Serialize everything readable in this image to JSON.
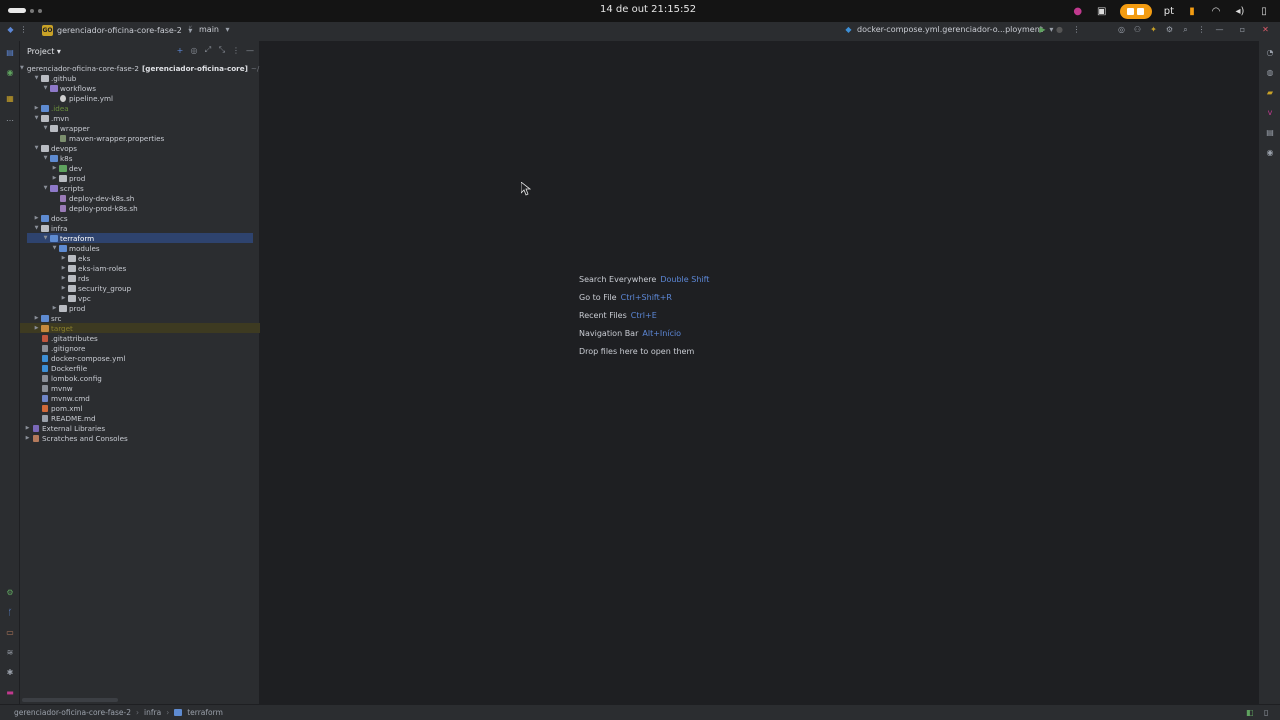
{
  "os": {
    "clock": "14 de out  21:15:52",
    "lang": "pt"
  },
  "toolbar": {
    "project_badge": "GO",
    "project_name": "gerenciador-oficina-core-fase-2",
    "branch": "main",
    "run_config": "docker-compose.yml.gerenciador-o...ployment"
  },
  "panel": {
    "title": "Project"
  },
  "tree": [
    {
      "label": "gerenciador-oficina-core-fase-2",
      "module": "[gerenciador-oficina-core]",
      "suffix": "~/..."
    },
    {
      "label": ".github"
    },
    {
      "label": "workflows"
    },
    {
      "label": "pipeline.yml"
    },
    {
      "label": ".idea"
    },
    {
      "label": ".mvn"
    },
    {
      "label": "wrapper"
    },
    {
      "label": "maven-wrapper.properties"
    },
    {
      "label": "devops"
    },
    {
      "label": "k8s"
    },
    {
      "label": "dev"
    },
    {
      "label": "prod"
    },
    {
      "label": "scripts"
    },
    {
      "label": "deploy-dev-k8s.sh"
    },
    {
      "label": "deploy-prod-k8s.sh"
    },
    {
      "label": "docs"
    },
    {
      "label": "infra"
    },
    {
      "label": "terraform"
    },
    {
      "label": "modules"
    },
    {
      "label": "eks"
    },
    {
      "label": "eks-iam-roles"
    },
    {
      "label": "rds"
    },
    {
      "label": "security_group"
    },
    {
      "label": "vpc"
    },
    {
      "label": "prod"
    },
    {
      "label": "src"
    },
    {
      "label": "target"
    },
    {
      "label": ".gitattributes"
    },
    {
      "label": ".gitignore"
    },
    {
      "label": "docker-compose.yml"
    },
    {
      "label": "Dockerfile"
    },
    {
      "label": "lombok.config"
    },
    {
      "label": "mvnw"
    },
    {
      "label": "mvnw.cmd"
    },
    {
      "label": "pom.xml"
    },
    {
      "label": "README.md"
    },
    {
      "label": "External Libraries"
    },
    {
      "label": "Scratches and Consoles"
    }
  ],
  "editor_hints": [
    {
      "label": "Search Everywhere",
      "key": "Double Shift"
    },
    {
      "label": "Go to File",
      "key": "Ctrl+Shift+R"
    },
    {
      "label": "Recent Files",
      "key": "Ctrl+E"
    },
    {
      "label": "Navigation Bar",
      "key": "Alt+Início"
    },
    {
      "label": "Drop files here to open them",
      "key": ""
    }
  ],
  "breadcrumb": [
    "gerenciador-oficina-core-fase-2",
    "infra",
    "terraform"
  ],
  "colors": {
    "selection": "#2e436e",
    "accent": "#5c87d6",
    "tray_orange": "#f39c12"
  }
}
